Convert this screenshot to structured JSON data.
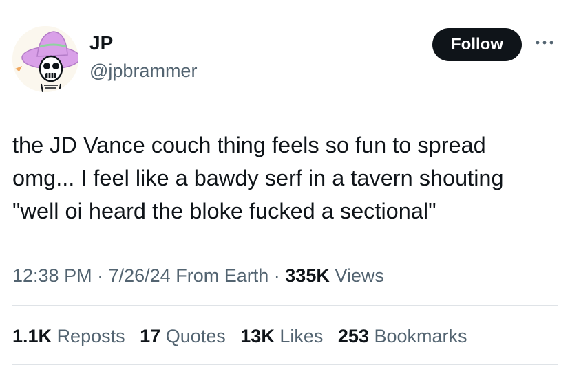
{
  "author": {
    "display_name": "JP",
    "handle": "@jpbrammer",
    "avatar_icon": "cartoon-skeleton-sombrero-avatar"
  },
  "actions": {
    "follow_label": "Follow",
    "more_icon": "more-horizontal-icon"
  },
  "tweet": {
    "lines": [
      "the JD Vance couch thing feels so fun to spread",
      "omg... I feel like a bawdy serf in a tavern shouting",
      "\"well oi heard the bloke fucked a sectional\""
    ]
  },
  "meta": {
    "time": "12:38 PM",
    "separator": "·",
    "date": "7/26/24",
    "source": "From Earth",
    "views_count": "335K",
    "views_label": "Views"
  },
  "stats": [
    {
      "count": "1.1K",
      "label": "Reposts"
    },
    {
      "count": "17",
      "label": "Quotes"
    },
    {
      "count": "13K",
      "label": "Likes"
    },
    {
      "count": "253",
      "label": "Bookmarks"
    }
  ],
  "colors": {
    "text_primary": "#0f1419",
    "text_secondary": "#536471",
    "button_bg": "#0f1419",
    "divider": "#dfe3e7",
    "avatar_hat": "#d9a0e8"
  }
}
